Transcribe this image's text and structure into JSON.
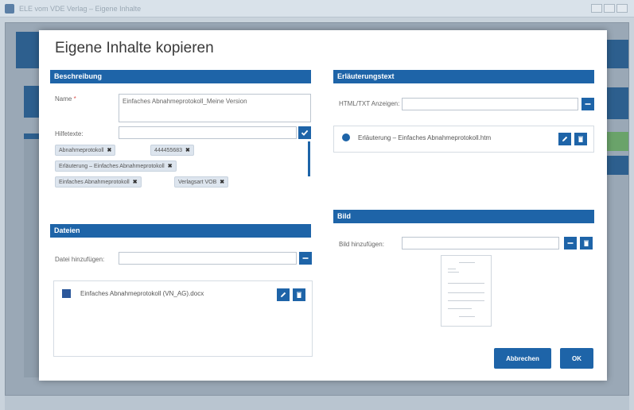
{
  "window": {
    "title": "ELE vom VDE Verlag – Eigene Inhalte"
  },
  "dialog": {
    "title": "Eigene Inhalte kopieren",
    "description": {
      "header": "Beschreibung",
      "name_label": "Name",
      "name_required_mark": "*",
      "name_value": "Einfaches Abnahmeprotokoll_Meine Version",
      "keywords_label": "Hilfetexte:",
      "keywords_value": "",
      "tags": [
        {
          "label": "Abnahmeprotokoll"
        },
        {
          "label": "444455683"
        },
        {
          "label": "Erläuterung – Einfaches Abnahmeprotokoll"
        },
        {
          "label": "Einfaches Abnahmeprotokoll"
        },
        {
          "label": "Verlagsart VOB"
        }
      ]
    },
    "explanation": {
      "header": "Erläuterungstext",
      "html_label": "HTML/TXT Anzeigen:",
      "html_value": "",
      "file_name": "Erläuterung – Einfaches Abnahmeprotokoll.htm"
    },
    "files": {
      "header": "Dateien",
      "add_label": "Datei hinzufügen:",
      "add_value": "",
      "file_name": "Einfaches Abnahmeprotokoll (VN_AG).docx"
    },
    "image": {
      "header": "Bild",
      "add_label": "Bild hinzufügen:",
      "add_value": ""
    },
    "cancel_label": "Abbrechen",
    "ok_label": "OK"
  },
  "colors": {
    "accent": "#1e64a8",
    "tag_bg": "#dde5ee"
  }
}
